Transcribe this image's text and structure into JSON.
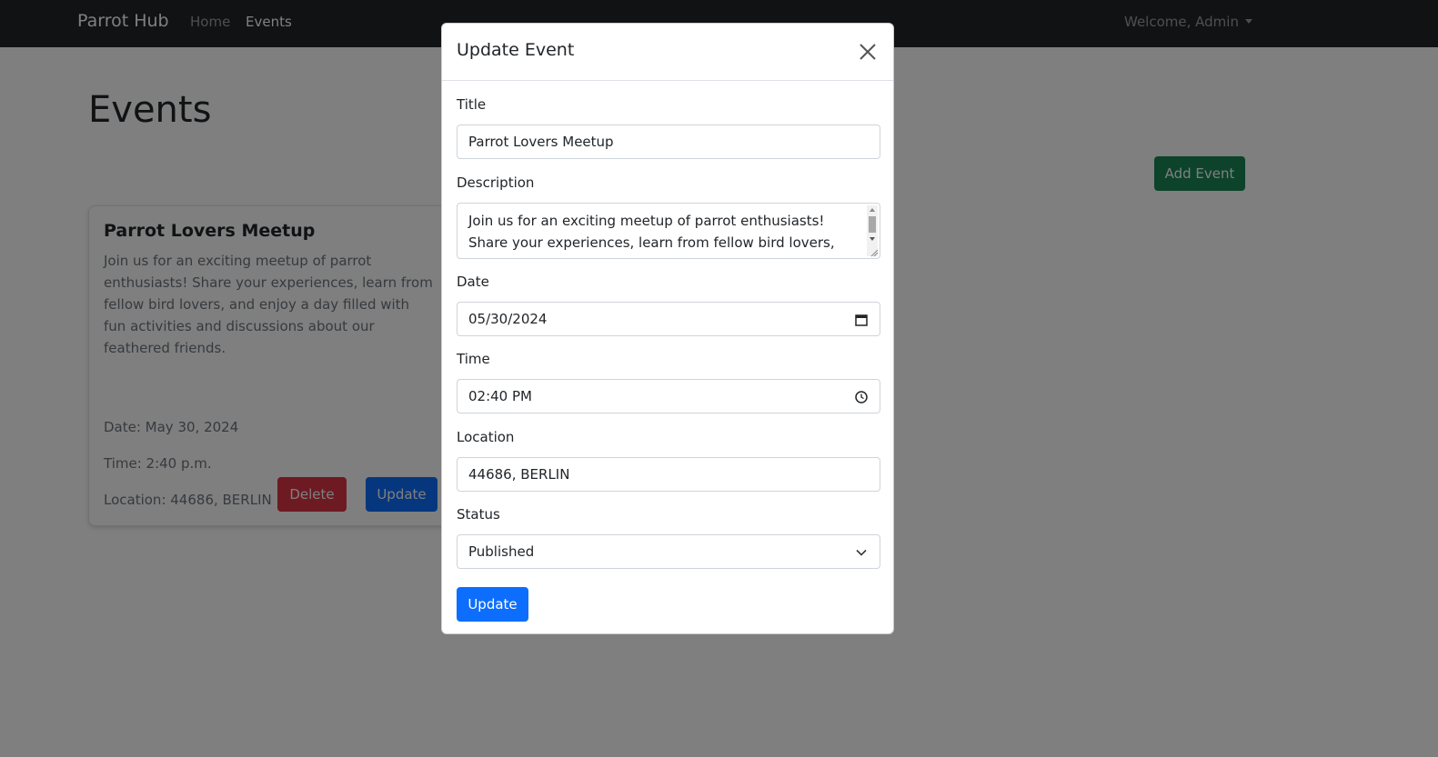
{
  "navbar": {
    "brand": "Parrot Hub",
    "links": [
      "Home",
      "Events"
    ],
    "active_link": "Events",
    "user_menu": "Welcome, Admin"
  },
  "page": {
    "title": "Events",
    "add_button": "Add Event"
  },
  "event_card": {
    "title": "Parrot Lovers Meetup",
    "description": "Join us for an exciting meetup of parrot enthusiasts! Share your experiences, learn from fellow bird lovers, and enjoy a day filled with fun activities and discussions about our feathered friends.",
    "date": "Date: May 30, 2024",
    "time": "Time: 2:40 p.m.",
    "location": "Location: 44686, BERLIN",
    "delete_button": "Delete",
    "update_button": "Update"
  },
  "modal": {
    "title": "Update Event",
    "fields": {
      "title_label": "Title",
      "title_value": "Parrot Lovers Meetup",
      "description_label": "Description",
      "description_value": "Join us for an exciting meetup of parrot enthusiasts! Share your experiences, learn from fellow bird lovers, and enjoy a day filled with fun activities and discussions about our feathered friends.",
      "date_label": "Date",
      "date_value": "05/30/2024",
      "time_label": "Time",
      "time_value": "02:40 PM",
      "location_label": "Location",
      "location_value": "44686, BERLIN",
      "status_label": "Status",
      "status_value": "Published"
    },
    "submit_button": "Update"
  },
  "colors": {
    "navbar_bg": "#212529",
    "success": "#198754",
    "danger": "#dc3545",
    "primary": "#0d6efd"
  },
  "icons": [
    "close-icon",
    "calendar-icon",
    "clock-icon",
    "chevron-down-icon",
    "caret-down-icon"
  ]
}
